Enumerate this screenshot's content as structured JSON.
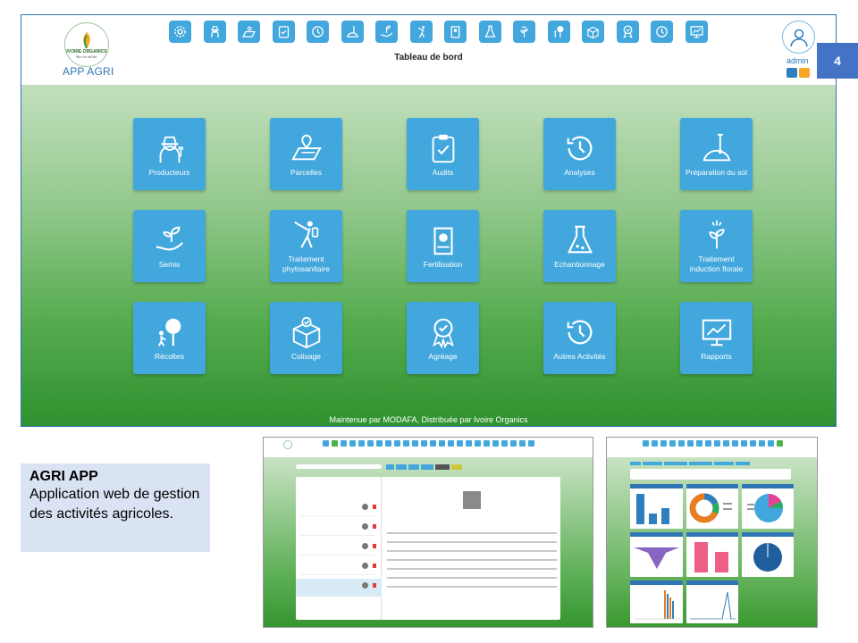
{
  "app": {
    "name": "APP AGRI",
    "logo_text": "IVOIRE ORGANICS",
    "logo_sub": "Bio for all life",
    "title": "Tableau de bord",
    "user": "admin"
  },
  "nav_icons": [
    "gear-icon",
    "farmer-icon",
    "parcel-map-icon",
    "audit-clipboard-icon",
    "analysis-history-icon",
    "soil-preparation-icon",
    "seedling-hand-icon",
    "sprayer-worker-icon",
    "fertilizer-bag-icon",
    "flask-icon",
    "floral-induction-icon",
    "harvest-tree-icon",
    "packing-box-icon",
    "approval-badge-icon",
    "other-activities-icon",
    "reports-chart-icon"
  ],
  "tiles": [
    {
      "label": "Producteurs",
      "icon": "farmer-icon"
    },
    {
      "label": "Parcelles",
      "icon": "parcel-map-icon"
    },
    {
      "label": "Audits",
      "icon": "audit-clipboard-icon"
    },
    {
      "label": "Analyses",
      "icon": "analysis-history-icon"
    },
    {
      "label": "Préparation du sol",
      "icon": "soil-preparation-icon"
    },
    {
      "label": "Semis",
      "icon": "seedling-hand-icon"
    },
    {
      "label": "Traitement phytosanitaire",
      "icon": "sprayer-worker-icon"
    },
    {
      "label": "Fertilisation",
      "icon": "fertilizer-bag-icon"
    },
    {
      "label": "Echantionnage",
      "icon": "flask-icon"
    },
    {
      "label": "Traitement induction florale",
      "icon": "floral-induction-icon"
    },
    {
      "label": "Récoltes",
      "icon": "harvest-tree-icon"
    },
    {
      "label": "Colisage",
      "icon": "packing-box-icon"
    },
    {
      "label": "Agréage",
      "icon": "approval-badge-icon"
    },
    {
      "label": "Autres Activités",
      "icon": "other-activities-icon"
    },
    {
      "label": "Rapports",
      "icon": "reports-chart-icon"
    }
  ],
  "footer": "Maintenue par MODAFA, Distribuée par Ivoire Organics",
  "page_number": "4",
  "description": {
    "title": "AGRI APP",
    "text": "Application web de gestion des activités agricoles."
  },
  "colors": {
    "tile": "#42a7dd",
    "accent": "#2e75b6",
    "green_dark": "#2f922f"
  }
}
